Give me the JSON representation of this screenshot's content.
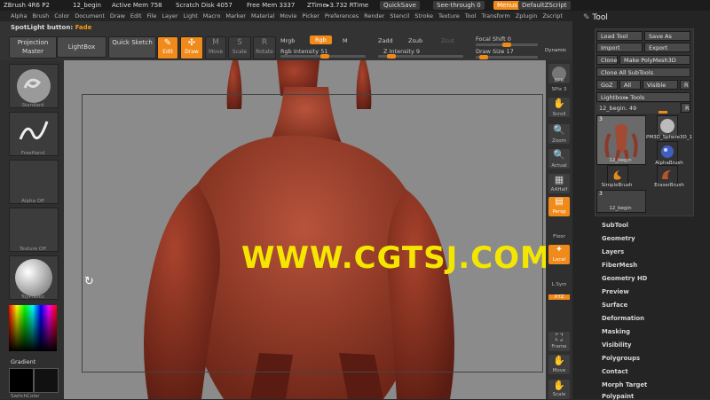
{
  "title_bar": {
    "app": "ZBrush 4R6 P2",
    "doc": "12_begin",
    "active_mem": "Active Mem 758",
    "scratch": "Scratch Disk 4057",
    "free_mem": "Free Mem 3337",
    "ztime": "ZTime▸3.732 RTime",
    "quicksave": "QuickSave",
    "see_through": "See-through  0",
    "menus": "Menus",
    "default_script": "DefaultZScript"
  },
  "menu": [
    "Alpha",
    "Brush",
    "Color",
    "Document",
    "Draw",
    "Edit",
    "File",
    "Layer",
    "Light",
    "Macro",
    "Marker",
    "Material",
    "Movie",
    "Picker",
    "Preferences",
    "Render",
    "Stencil",
    "Stroke",
    "Texture",
    "Tool",
    "Transform",
    "Zplugin",
    "Zscript"
  ],
  "shelf": {
    "spotlight_label": "SpotLight button:",
    "spotlight_value": "Fade",
    "projection_master": "Projection Master",
    "lightbox": "LightBox",
    "quick_sketch": "Quick Sketch",
    "edit": "Edit",
    "draw": "Draw",
    "move": "Move",
    "scale": "Scale",
    "rotate": "Rotate",
    "mrgb": "Mrgb",
    "rgb": "Rgb",
    "m": "M",
    "rgb_intensity": "Rgb Intensity 51",
    "zadd": "Zadd",
    "zsub": "Zsub",
    "zcut": "Zcut",
    "z_intensity": "Z Intensity 9",
    "focal_shift": "Focal Shift 0",
    "draw_size": "Draw Size 17",
    "dynamic": "Dynamic"
  },
  "left_tray": {
    "standard": "Standard",
    "freehand": "FreeHand",
    "alpha_off": "Alpha Off",
    "texture_off": "Texture Off",
    "material": "ToyPlastic",
    "gradient": "Gradient",
    "switch_color": "SwitchColor"
  },
  "viewport": {
    "watermark": "WWW.CGTSJ.COM"
  },
  "right_tray": [
    "BPR",
    "SPix 3",
    "Scroll",
    "Zoom",
    "Actual",
    "AAHalf",
    "Persp",
    "Floor",
    "Local",
    "L.Sym",
    "XYZ",
    "Frame",
    "Move",
    "Scale"
  ],
  "tool_palette": {
    "title": "Tool",
    "load_tool": "Load Tool",
    "save_as": "Save As",
    "import": "Import",
    "export": "Export",
    "clone": "Clone",
    "make_polymesh": "Make PolyMesh3D",
    "clone_all": "Clone All SubTools",
    "goz": "GoZ",
    "all": "All",
    "visible": "Visible",
    "r": "R",
    "lightbox_tools": "Lightbox▸ Tools",
    "current_tool": "12_begin. 49",
    "thumbs": [
      {
        "name": "12_begin",
        "count": "3"
      },
      {
        "name": "PM3D_Sphere3D_1",
        "count": ""
      },
      {
        "name": "AlphaBrush",
        "count": ""
      },
      {
        "name": "SimpleBrush",
        "count": ""
      },
      {
        "name": "EraserBrush",
        "count": ""
      },
      {
        "name": "12_begin",
        "count": "3"
      }
    ],
    "sections": [
      "SubTool",
      "Geometry",
      "Layers",
      "FiberMesh",
      "Geometry HD",
      "Preview",
      "Surface",
      "Deformation",
      "Masking",
      "Visibility",
      "Polygroups",
      "Contact",
      "Morph Target",
      "Polypaint"
    ]
  }
}
